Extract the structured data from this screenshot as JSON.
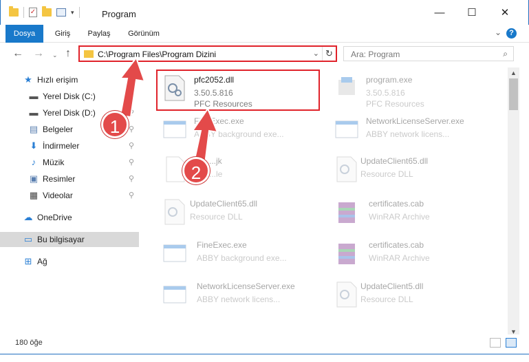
{
  "window": {
    "title": "Program",
    "minimize": "—",
    "maximize": "☐",
    "close": "✕"
  },
  "ribbon": {
    "tabs": [
      "Dosya",
      "Giriş",
      "Paylaş",
      "Görünüm"
    ],
    "help": "?"
  },
  "nav": {
    "address": "C:\\Program Files\\Program Dizini",
    "search_placeholder": "Ara: Program"
  },
  "sidebar": {
    "items": [
      {
        "label": "Hızlı erişim",
        "icon": "star-icon"
      },
      {
        "label": "Yerel Disk (C:)",
        "icon": "drive-icon"
      },
      {
        "label": "Yerel Disk (D:)",
        "icon": "drive-icon"
      },
      {
        "label": "Belgeler",
        "icon": "documents-icon"
      },
      {
        "label": "İndirmeler",
        "icon": "download-icon"
      },
      {
        "label": "Müzik",
        "icon": "music-icon"
      },
      {
        "label": "Resimler",
        "icon": "pictures-icon"
      },
      {
        "label": "Videolar",
        "icon": "videos-icon"
      },
      {
        "label": "OneDrive",
        "icon": "cloud-icon"
      },
      {
        "label": "Bu bilgisayar",
        "icon": "computer-icon"
      },
      {
        "label": "Ağ",
        "icon": "network-icon"
      }
    ]
  },
  "files": [
    {
      "name": "pfc2052.dll",
      "line2": "3.50.5.816",
      "line3": "PFC Resources"
    },
    {
      "name": "program.exe",
      "line2": "3.50.5.816",
      "line3": "PFC Resources"
    },
    {
      "name": "FineExec.exe",
      "line2": "ABBY background exe...",
      "line3": ""
    },
    {
      "name": "NetworkLicenseServer.exe",
      "line2": "ABBY network licens...",
      "line3": ""
    },
    {
      "name": "...jk",
      "line2": "...le",
      "line3": ""
    },
    {
      "name": "UpdateClient65.dll",
      "line2": "Resource DLL",
      "line3": ""
    },
    {
      "name": "UpdateClient65.dll",
      "line2": "Resource DLL",
      "line3": ""
    },
    {
      "name": "certificates.cab",
      "line2": "WinRAR Archive",
      "line3": ""
    },
    {
      "name": "FineExec.exe",
      "line2": "ABBY background exe...",
      "line3": ""
    },
    {
      "name": "certificates.cab",
      "line2": "WinRAR Archive",
      "line3": ""
    },
    {
      "name": "NetworkLicenseServer.exe",
      "line2": "ABBY network licens...",
      "line3": ""
    },
    {
      "name": "UpdateClient5.dll",
      "line2": "Resource DLL",
      "line3": ""
    }
  ],
  "status": {
    "count": "180 öğe"
  },
  "annotations": {
    "step1": "1",
    "step2": "2",
    "color": "#e34a4a"
  }
}
